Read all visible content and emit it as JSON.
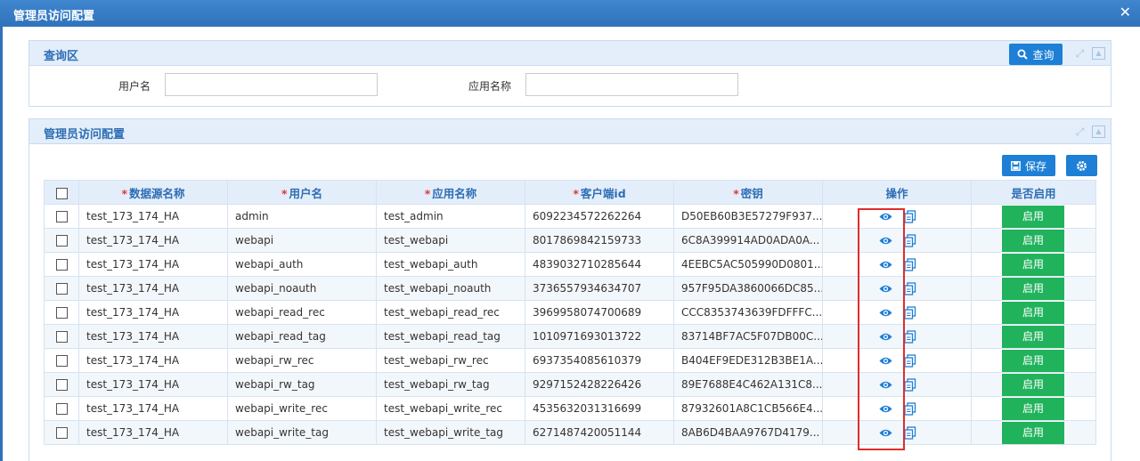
{
  "window": {
    "title": "管理员访问配置",
    "close_glyph": "✕"
  },
  "query_panel": {
    "title": "查询区",
    "search_label": "查询",
    "fields": [
      {
        "label": "用户名",
        "value": "",
        "placeholder": ""
      },
      {
        "label": "应用名称",
        "value": "",
        "placeholder": ""
      }
    ]
  },
  "grid_panel": {
    "title": "管理员访问配置",
    "save_label": "保存",
    "columns": [
      "数据源名称",
      "用户名",
      "应用名称",
      "客户端id",
      "密钥",
      "操作",
      "是否启用"
    ],
    "rows": [
      [
        "test_173_174_HA",
        "admin",
        "test_admin",
        "6092234572262264",
        "D50EB60B3E57279F937...",
        "启用"
      ],
      [
        "test_173_174_HA",
        "webapi",
        "test_webapi",
        "8017869842159733",
        "6C8A399914AD0ADA0A...",
        "启用"
      ],
      [
        "test_173_174_HA",
        "webapi_auth",
        "test_webapi_auth",
        "4839032710285644",
        "4EEBC5AC505990D0801...",
        "启用"
      ],
      [
        "test_173_174_HA",
        "webapi_noauth",
        "test_webapi_noauth",
        "3736557934634707",
        "957F95DA3860066DC85...",
        "启用"
      ],
      [
        "test_173_174_HA",
        "webapi_read_rec",
        "test_webapi_read_rec",
        "3969958074700689",
        "CCC8353743639FDFFFC...",
        "启用"
      ],
      [
        "test_173_174_HA",
        "webapi_read_tag",
        "test_webapi_read_tag",
        "1010971693013722",
        "83714BF7AC5F07DB00C...",
        "启用"
      ],
      [
        "test_173_174_HA",
        "webapi_rw_rec",
        "test_webapi_rw_rec",
        "6937354085610379",
        "B404EF9EDE312B3BE1A...",
        "启用"
      ],
      [
        "test_173_174_HA",
        "webapi_rw_tag",
        "test_webapi_rw_tag",
        "9297152428226426",
        "89E7688E4C462A131C8...",
        "启用"
      ],
      [
        "test_173_174_HA",
        "webapi_write_rec",
        "test_webapi_write_rec",
        "4535632031316699",
        "87932601A8C1CB566E4...",
        "启用"
      ],
      [
        "test_173_174_HA",
        "webapi_write_tag",
        "test_webapi_write_tag",
        "6271487420051144",
        "8AB6D4BAA9767D4179...",
        "启用"
      ]
    ]
  },
  "colors": {
    "accent": "#1e7fd6",
    "enable_green": "#21b25c",
    "highlight_red": "#e02c2c",
    "title_bar": "#2f72bb"
  },
  "icons": [
    "close-icon",
    "search-icon",
    "expand-icon",
    "collapse-icon",
    "save-icon",
    "gear-icon",
    "eye-icon",
    "copy-icon"
  ]
}
